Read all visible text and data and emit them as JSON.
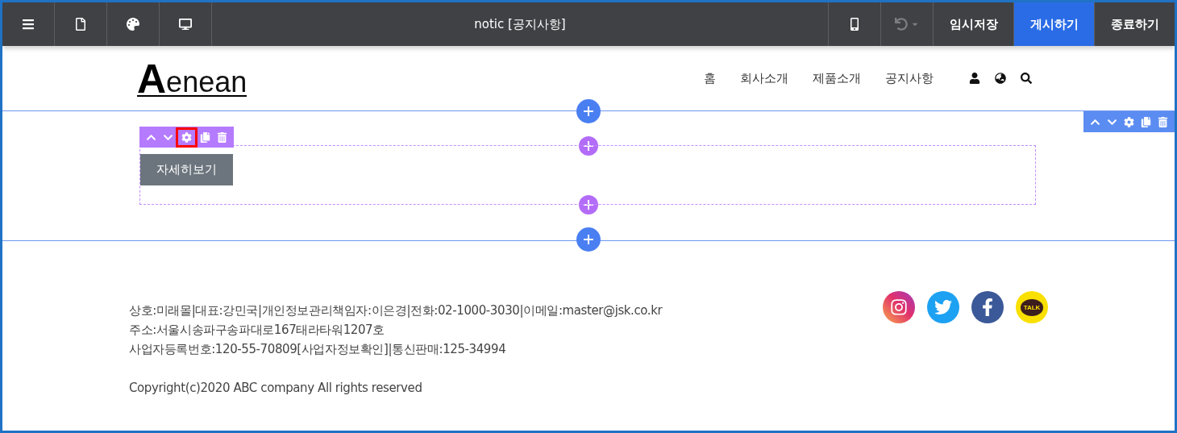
{
  "topbar": {
    "left_tools": [
      {
        "kind": "menu"
      },
      {
        "kind": "page"
      },
      {
        "kind": "palette"
      },
      {
        "kind": "desktop"
      }
    ],
    "title": "notic [공지사항]",
    "right_tools": [
      {
        "kind": "mobile",
        "disabled": false
      },
      {
        "kind": "undo",
        "disabled": true
      }
    ],
    "actions": [
      {
        "label": "임시저장",
        "kind": "plain"
      },
      {
        "label": "게시하기",
        "kind": "primary"
      },
      {
        "label": "종료하기",
        "kind": "plain"
      }
    ]
  },
  "header": {
    "logo": {
      "initial": "A",
      "rest": "enean"
    },
    "nav": [
      {
        "label": "홈"
      },
      {
        "label": "회사소개"
      },
      {
        "label": "제품소개"
      },
      {
        "label": "공지사항"
      }
    ],
    "icons": [
      {
        "kind": "user"
      },
      {
        "kind": "globe"
      },
      {
        "kind": "search"
      }
    ]
  },
  "section": {
    "tools": [
      {
        "kind": "up"
      },
      {
        "kind": "down"
      },
      {
        "kind": "settings"
      },
      {
        "kind": "copy"
      },
      {
        "kind": "delete"
      }
    ],
    "block": {
      "tools": [
        {
          "kind": "up",
          "highlighted": false
        },
        {
          "kind": "down",
          "highlighted": false
        },
        {
          "kind": "settings",
          "highlighted": true
        },
        {
          "kind": "copy",
          "highlighted": false
        },
        {
          "kind": "delete",
          "highlighted": false
        }
      ],
      "button": "자세히보기"
    }
  },
  "footer": {
    "lines": [
      "상호:미래몰|대표:강민국|개인정보관리책임자:이은경|전화:02-1000-3030|이메일:master@jsk.co.kr",
      "주소:서울시송파구송파대로167태라타워1207호",
      "사업자등록번호:120-55-70809[사업자정보확인]|통신판매:125-34994"
    ],
    "copyright": "Copyright(c)2020 ABC company All rights reserved",
    "social": [
      {
        "kind": "instagram"
      },
      {
        "kind": "twitter"
      },
      {
        "kind": "facebook"
      },
      {
        "kind": "kakao",
        "label": "TALK"
      }
    ]
  }
}
